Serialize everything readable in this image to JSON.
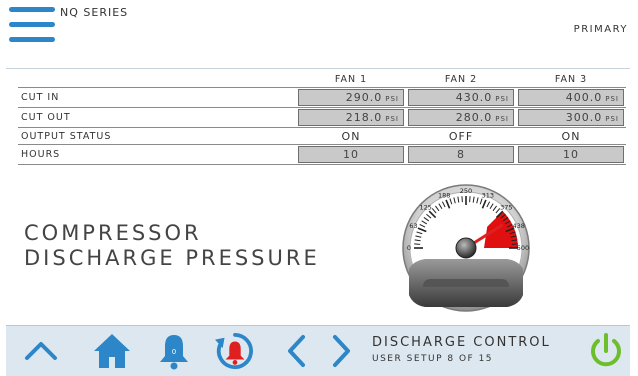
{
  "header": {
    "series": "NQ SERIES",
    "mode": "PRIMARY"
  },
  "table": {
    "columns": [
      "FAN 1",
      "FAN 2",
      "FAN 3"
    ],
    "rows": [
      {
        "label": "CUT IN",
        "values": [
          "290.0",
          "430.0",
          "400.0"
        ],
        "unit": "PSI"
      },
      {
        "label": "CUT OUT",
        "values": [
          "218.0",
          "280.0",
          "300.0"
        ],
        "unit": "PSI"
      },
      {
        "label": "OUTPUT STATUS",
        "values": [
          "ON",
          "OFF",
          "ON"
        ]
      },
      {
        "label": "HOURS",
        "values": [
          "10",
          "8",
          "10"
        ]
      }
    ]
  },
  "gauge": {
    "title_line1": "COMPRESSOR",
    "title_line2": "DISCHARGE PRESSURE",
    "scale_labels": [
      "0",
      "63",
      "125",
      "188",
      "250",
      "313",
      "375",
      "438",
      "500"
    ],
    "min": 0,
    "max": 500,
    "value": 410,
    "red_zone_start": 375,
    "colors": {
      "needle": "#e02020",
      "red_zone": "#e01010"
    }
  },
  "footer": {
    "screen_title": "DISCHARGE CONTROL",
    "screen_subtitle": "USER SETUP 8 OF 15",
    "bell_badge": "0",
    "icons": [
      "chevron-up-icon",
      "home-icon",
      "bell-icon",
      "alarm-history-icon",
      "chevron-left-icon",
      "chevron-right-icon",
      "power-icon"
    ],
    "colors": {
      "nav_blue": "#2c86c7",
      "alarm_red": "#e02020",
      "power_green": "#6cbf2a"
    }
  }
}
